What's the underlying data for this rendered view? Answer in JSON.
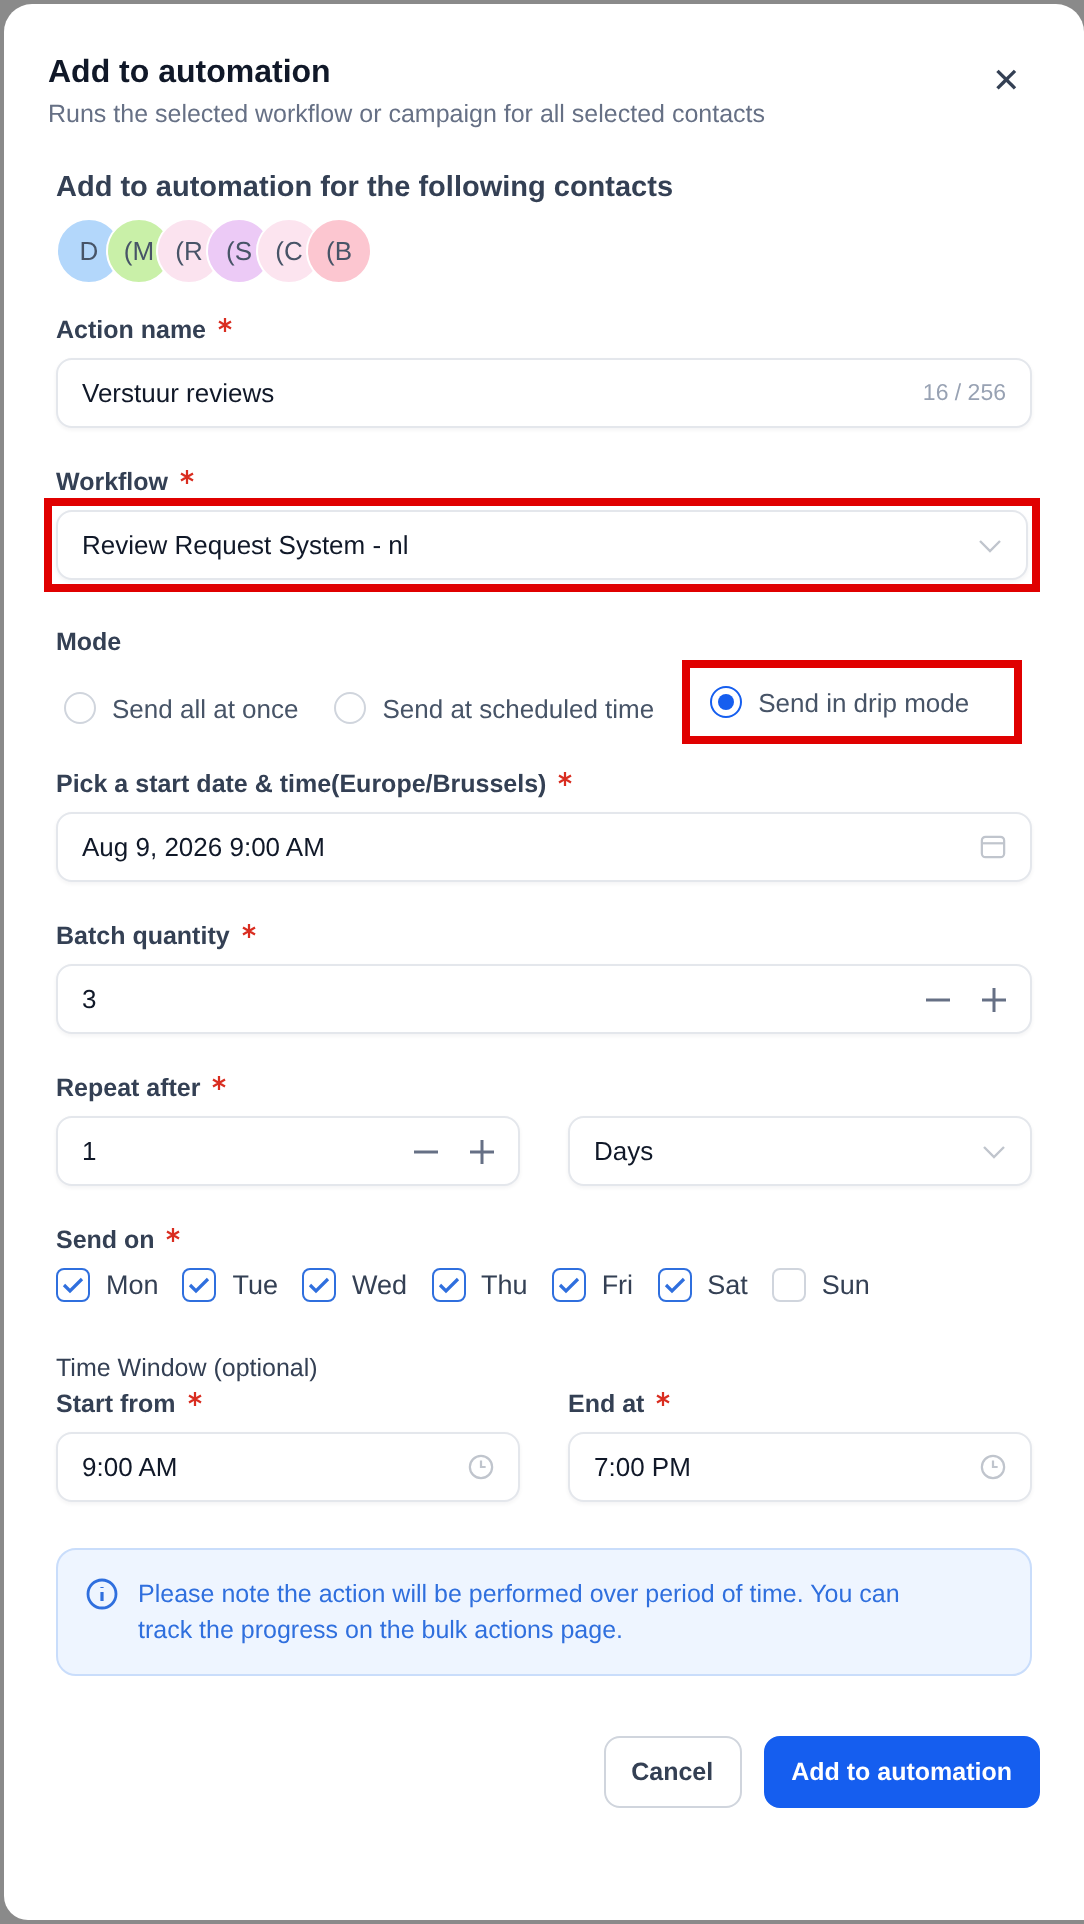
{
  "dialog": {
    "title": "Add to automation",
    "subtitle": "Runs the selected workflow or campaign for all selected contacts",
    "close_icon": "✕"
  },
  "contacts": {
    "heading": "Add to automation for the following contacts",
    "avatars": [
      {
        "initials": "D",
        "color": "#b3d7fb"
      },
      {
        "initials": "(M",
        "color": "#c9f0a8"
      },
      {
        "initials": "(R",
        "color": "#fbe3ef"
      },
      {
        "initials": "(S",
        "color": "#eccaf6"
      },
      {
        "initials": "(C",
        "color": "#fce4ef"
      },
      {
        "initials": "(B",
        "color": "#fcc6d0"
      }
    ]
  },
  "action_name": {
    "label": "Action name",
    "required": true,
    "value": "Verstuur reviews",
    "counter": "16 / 256"
  },
  "workflow": {
    "label": "Workflow",
    "required": true,
    "value": "Review Request System - nl",
    "highlighted": true
  },
  "mode": {
    "label": "Mode",
    "options": [
      {
        "label": "Send all at once",
        "selected": false,
        "highlighted": false
      },
      {
        "label": "Send at scheduled time",
        "selected": false,
        "highlighted": false
      },
      {
        "label": "Send in drip mode",
        "selected": true,
        "highlighted": true
      }
    ]
  },
  "start": {
    "label": "Pick a start date & time(Europe/Brussels)",
    "required": true,
    "value": "Aug 9, 2026 9:00 AM"
  },
  "batch": {
    "label": "Batch quantity",
    "required": true,
    "value": "3"
  },
  "repeat": {
    "label": "Repeat after",
    "required": true,
    "value": "1",
    "unit": "Days"
  },
  "send_on": {
    "label": "Send on",
    "required": true,
    "days": [
      {
        "label": "Mon",
        "checked": true
      },
      {
        "label": "Tue",
        "checked": true
      },
      {
        "label": "Wed",
        "checked": true
      },
      {
        "label": "Thu",
        "checked": true
      },
      {
        "label": "Fri",
        "checked": true
      },
      {
        "label": "Sat",
        "checked": true
      },
      {
        "label": "Sun",
        "checked": false
      }
    ]
  },
  "time_window": {
    "heading": "Time Window (optional)",
    "start": {
      "label": "Start from",
      "required": true,
      "value": "9:00 AM"
    },
    "end": {
      "label": "End at",
      "required": true,
      "value": "7:00 PM"
    }
  },
  "notice": "Please note the action will be performed over period of time. You can track the progress on the bulk actions page.",
  "buttons": {
    "cancel": "Cancel",
    "submit": "Add to automation"
  }
}
